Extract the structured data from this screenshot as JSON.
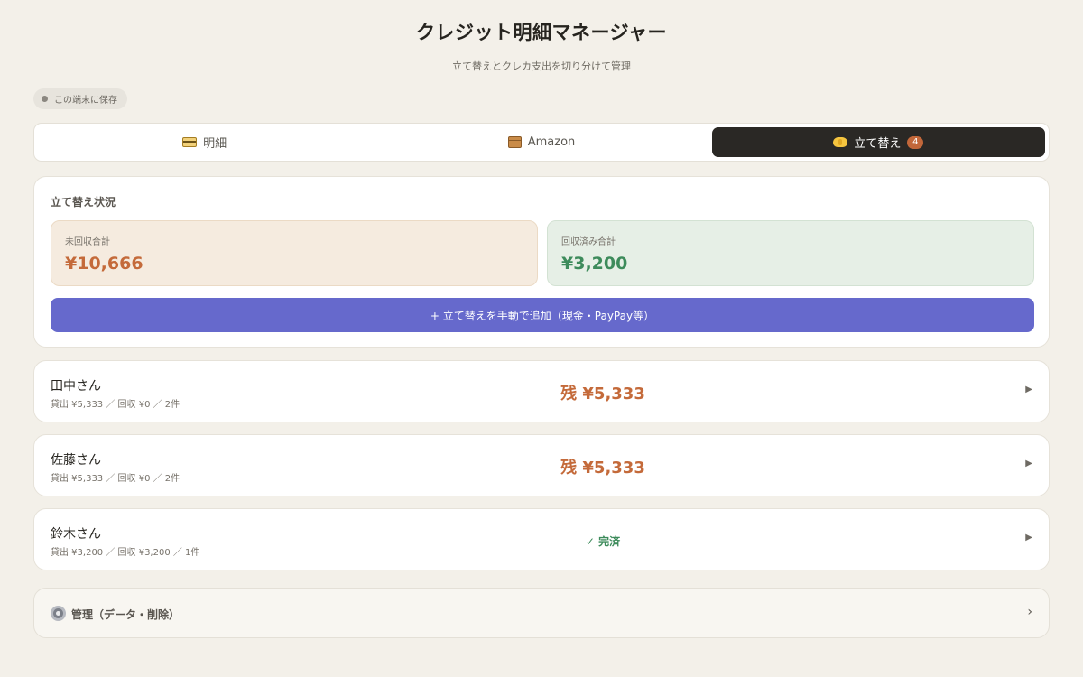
{
  "header": {
    "title": "クレジット明細マネージャー",
    "subtitle": "立て替えとクレカ支出を切り分けて管理",
    "storage_chip": "この端末に保存"
  },
  "tabs": [
    {
      "label": "明細",
      "icon": "credit-card-icon",
      "active": false
    },
    {
      "label": "Amazon",
      "icon": "package-icon",
      "active": false
    },
    {
      "label": "立て替え",
      "icon": "handshake-icon",
      "active": true,
      "badge": "4"
    }
  ],
  "summary": {
    "title": "立て替え状況",
    "unpaid_label": "未回収合計",
    "unpaid_value": "¥10,666",
    "paid_label": "回収済み合計",
    "paid_value": "¥3,200",
    "add_button": "+ 立て替えを手動で追加（現金・PayPay等）"
  },
  "people": [
    {
      "name": "田中さん",
      "detail": "貸出 ¥5,333 ／ 回収 ¥0 ／ 2件",
      "status": "残 ¥5,333",
      "settled": false
    },
    {
      "name": "佐藤さん",
      "detail": "貸出 ¥5,333 ／ 回収 ¥0 ／ 2件",
      "status": "残 ¥5,333",
      "settled": false
    },
    {
      "name": "鈴木さん",
      "detail": "貸出 ¥3,200 ／ 回収 ¥3,200 ／ 1件",
      "status": "✓ 完済",
      "settled": true
    }
  ],
  "manage": {
    "label": "管理（データ・削除）",
    "icon": "gear-icon",
    "arrow": "›"
  },
  "row_arrow": "▶",
  "colors": {
    "background": "#f3f0e9",
    "unpaid": "#c46a3a",
    "paid": "#3d8b5b",
    "accent": "#6669cc",
    "active_tab": "#2a2825",
    "badge": "#c2673a"
  }
}
